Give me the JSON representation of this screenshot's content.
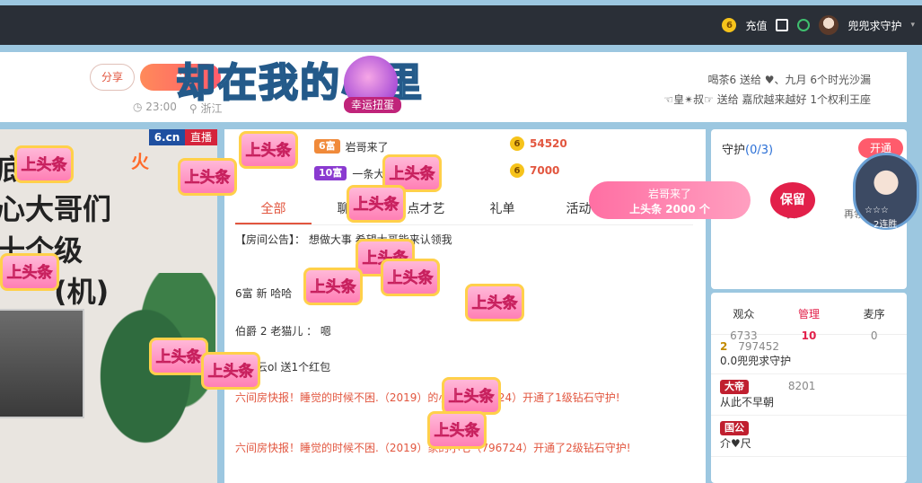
{
  "topbar": {
    "recharge": "充值",
    "username": "兜兜求守护",
    "coin_symbol": "6"
  },
  "header": {
    "share": "分享",
    "time": "23:00",
    "location": "浙江",
    "overlay_lyric": "却在我的心里",
    "lucky_egg": "幸运扭蛋",
    "news": [
      "喝茶6 送给 ♥、九月 6个时光沙漏",
      "☜皇✴叔☞ 送给 嘉欣越来越好 1个权利王座"
    ]
  },
  "video": {
    "logo": "6.cn",
    "live_badge": "直播",
    "fire_label": "火",
    "overlay_text": [
      "底",
      "心大哥们",
      "十个级",
      "(机)"
    ]
  },
  "chat": {
    "rank": [
      {
        "tag": "6富",
        "name": "岩哥来了",
        "value": "54520"
      },
      {
        "tag": "10富",
        "name": "一条大",
        "value": "7000"
      }
    ],
    "tabs": [
      "全部",
      "聊天",
      "点才艺",
      "礼单",
      "活动"
    ],
    "messages": [
      "【房间公告】： 想做大事 希望大哥能来认领我",
      "6富  新  哈哈",
      "伯爵  2  老猫儿 ： 嗯",
      "东风云ol 送1个红包",
      "六间房快报！睡觉的时候不困.（2019）的小七（796724）开通了1级钻石守护!",
      "六间房快报！睡觉的时候不困.（2019）家的小七（796724）开通了2级钻石守护!"
    ],
    "sticker_label": "上头条"
  },
  "guard": {
    "title": "守护",
    "count": "(0/3)",
    "open_btn": "开通",
    "link1": "守护",
    "link2": "再领",
    "streak": "2连胜",
    "stars": "☆☆☆"
  },
  "gift_banner": {
    "line1": "岩哥来了",
    "line2": "上头条 2000 个",
    "keep": "保留"
  },
  "audience": {
    "tabs": [
      {
        "label": "观众",
        "count": "6733"
      },
      {
        "label": "管理",
        "count": "10"
      },
      {
        "label": "麦序",
        "count": "0"
      }
    ],
    "rows": [
      {
        "rank": "2",
        "id": "797452",
        "name": "0.0兜兜求守护"
      },
      {
        "tag": "大帝",
        "id": "8201",
        "name": "从此不早朝"
      },
      {
        "tag": "国公",
        "name": "介♥尺"
      }
    ]
  }
}
